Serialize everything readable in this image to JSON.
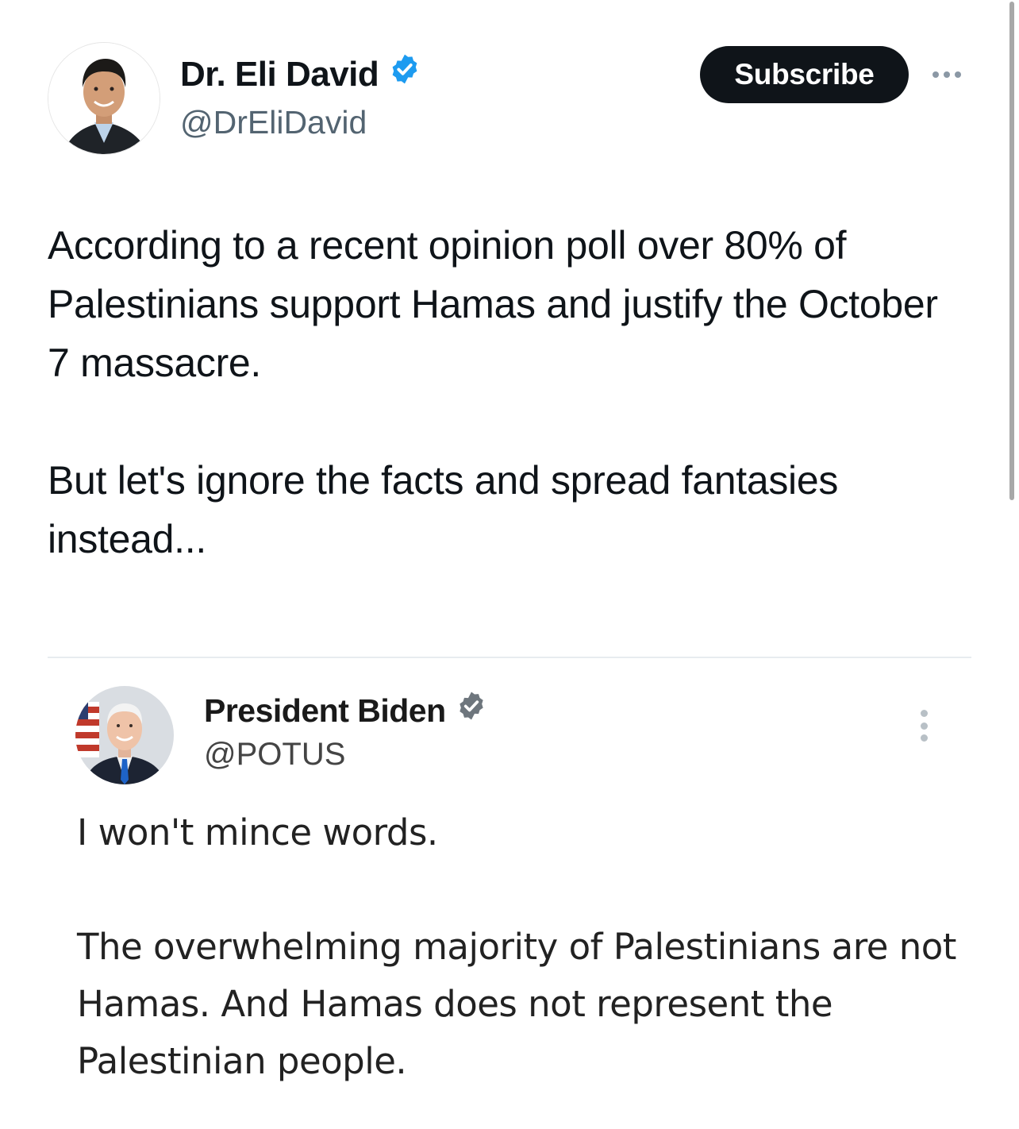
{
  "author": {
    "display_name": "Dr. Eli David",
    "handle": "@DrEliDavid",
    "verified": true,
    "verified_color": "#1d9bf0"
  },
  "actions": {
    "subscribe_label": "Subscribe"
  },
  "tweet": {
    "paragraph_1": "According to a recent opinion poll over 80% of Palestinians support Hamas and justify the October 7 massacre.",
    "paragraph_2": "But let's ignore the facts and spread fantasies instead..."
  },
  "quoted_tweet": {
    "display_name": "President Biden",
    "handle": "@POTUS",
    "verified": true,
    "verified_color": "#6e767d",
    "paragraph_1": "I won't mince words.",
    "paragraph_2": "The overwhelming majority of Palestinians are not Hamas. And Hamas does not represent the Palestinian people."
  },
  "icons": {
    "author_more": "more-horizontal-icon",
    "quote_more": "more-vertical-icon",
    "verified": "verified-badge-icon"
  }
}
